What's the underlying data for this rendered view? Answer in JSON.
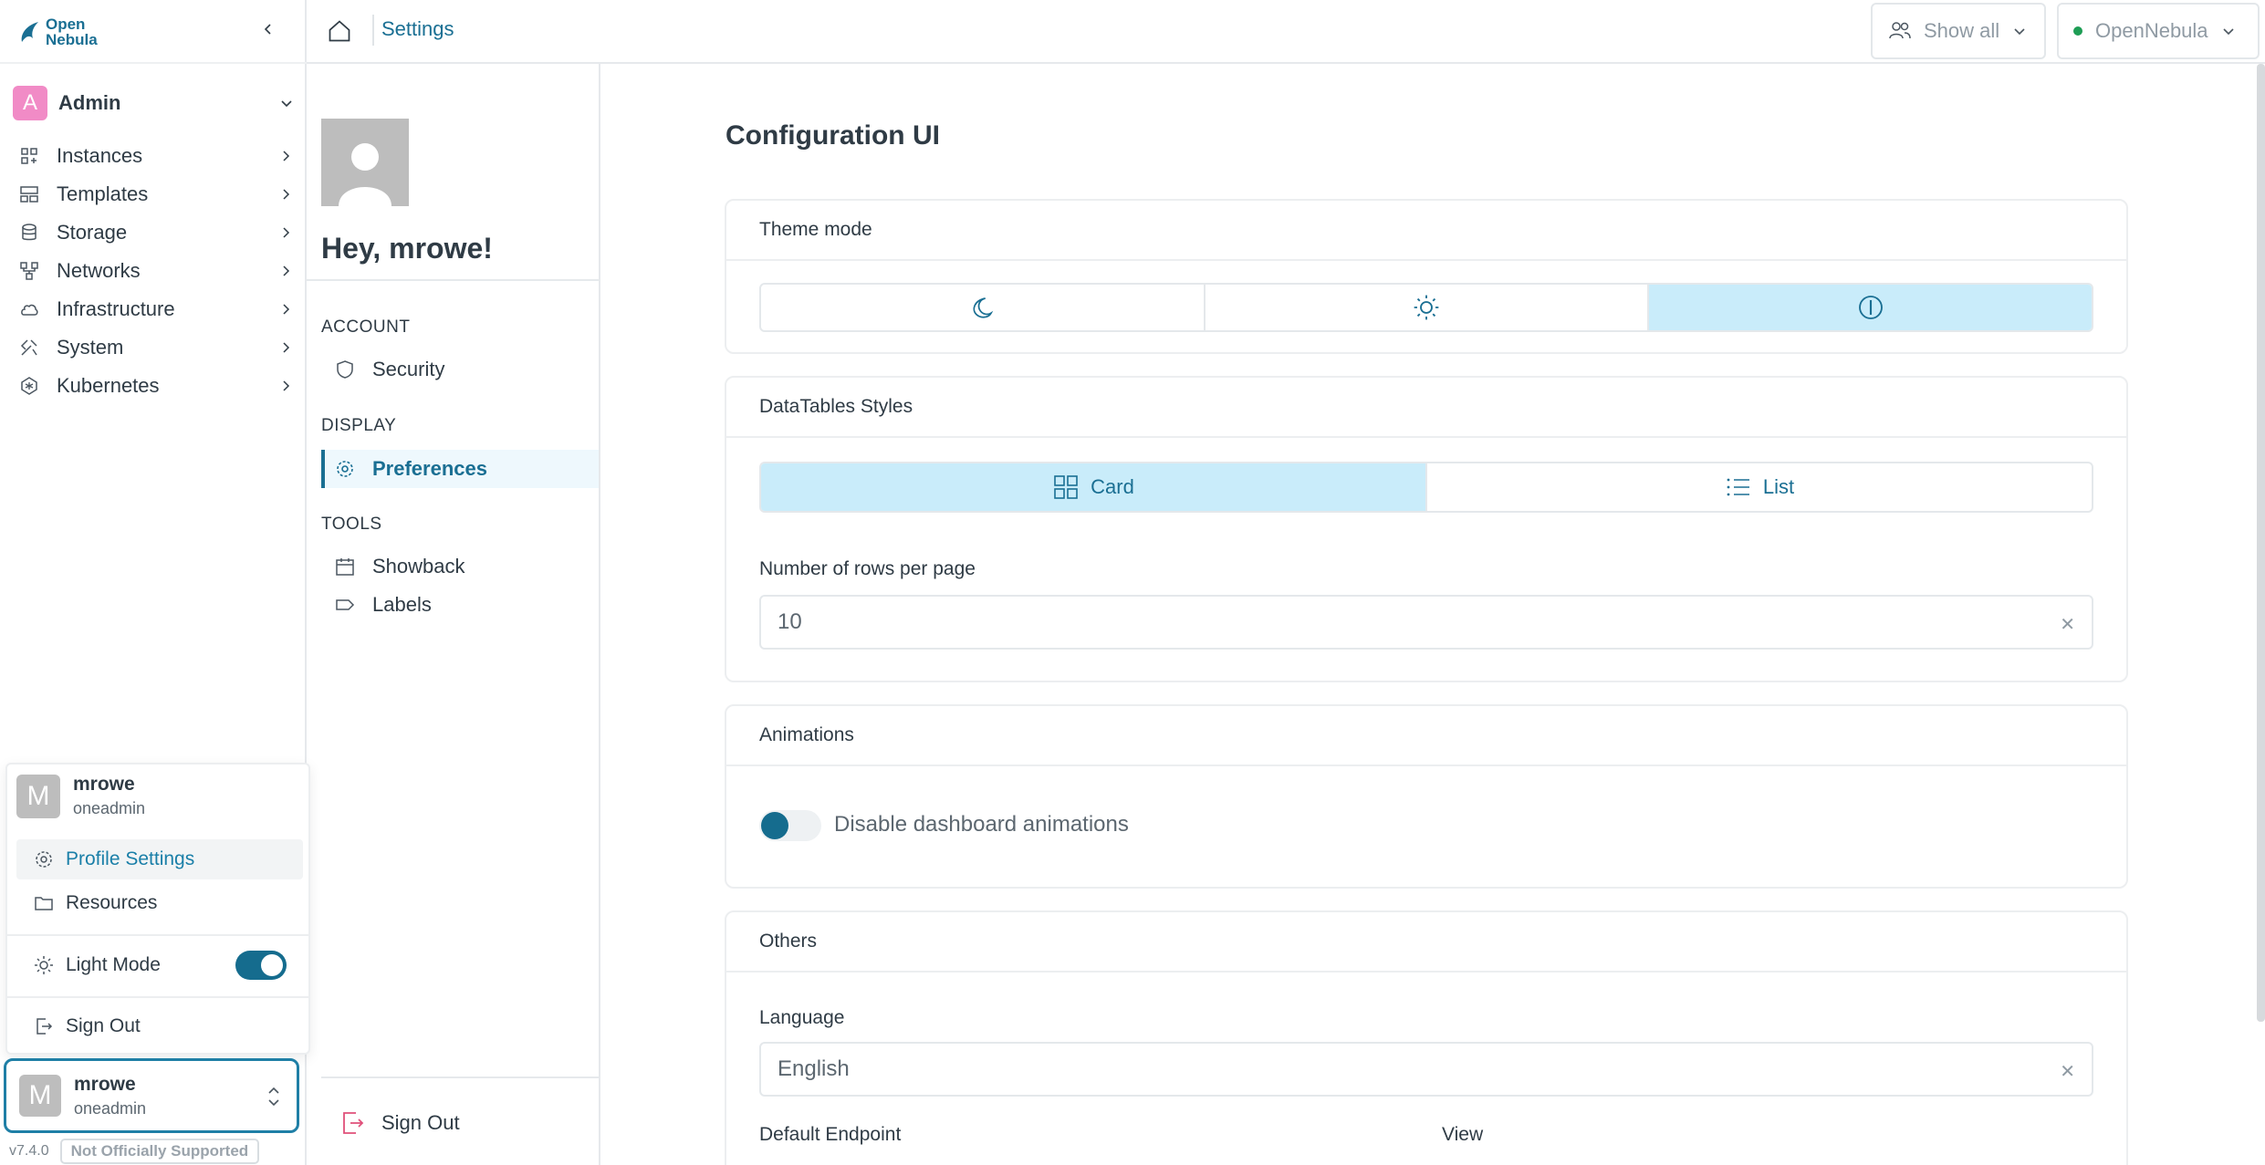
{
  "app": {
    "logo_line1": "Open",
    "logo_line2": "Nebula",
    "version": "v7.4.0",
    "support_badge": "Not Officially Supported"
  },
  "sidebar": {
    "group_avatar": "A",
    "group_label": "Admin",
    "items": [
      {
        "label": "Instances",
        "icon": "instances-icon"
      },
      {
        "label": "Templates",
        "icon": "templates-icon"
      },
      {
        "label": "Storage",
        "icon": "storage-icon"
      },
      {
        "label": "Networks",
        "icon": "networks-icon"
      },
      {
        "label": "Infrastructure",
        "icon": "cloud-icon"
      },
      {
        "label": "System",
        "icon": "tools-icon"
      },
      {
        "label": "Kubernetes",
        "icon": "kubernetes-icon"
      }
    ]
  },
  "user_menu": {
    "avatar": "M",
    "username": "mrowe",
    "group": "oneadmin",
    "profile_settings": "Profile Settings",
    "resources": "Resources",
    "light_mode": "Light Mode",
    "sign_out": "Sign Out"
  },
  "current_user": {
    "avatar": "M",
    "username": "mrowe",
    "group": "oneadmin"
  },
  "topbar": {
    "breadcrumb": "Settings",
    "filter_label": "Show all",
    "zone_label": "OpenNebula"
  },
  "settings_nav": {
    "greeting": "Hey, mrowe!",
    "sections": [
      {
        "title": "ACCOUNT",
        "items": [
          {
            "label": "Security"
          }
        ]
      },
      {
        "title": "DISPLAY",
        "items": [
          {
            "label": "Preferences"
          }
        ]
      },
      {
        "title": "TOOLS",
        "items": [
          {
            "label": "Showback"
          },
          {
            "label": "Labels"
          }
        ]
      }
    ],
    "sign_out": "Sign Out"
  },
  "main": {
    "title": "Configuration UI",
    "theme_card": {
      "title": "Theme mode",
      "selected": "system"
    },
    "datatables_card": {
      "title": "DataTables Styles",
      "card_label": "Card",
      "list_label": "List",
      "selected": "Card",
      "rows_label": "Number of rows per page",
      "rows_value": "10"
    },
    "animations_card": {
      "title": "Animations",
      "toggle_label": "Disable dashboard animations"
    },
    "others_card": {
      "title": "Others",
      "language_label": "Language",
      "language_value": "English",
      "endpoint_label": "Default Endpoint",
      "view_label": "View"
    }
  },
  "colors": {
    "accent": "#1a6f93",
    "selected_bg": "#c9ecfa",
    "admin_avatar": "#f18bc6",
    "status_online": "#1e9d55",
    "toggle_on": "#156c8e"
  }
}
